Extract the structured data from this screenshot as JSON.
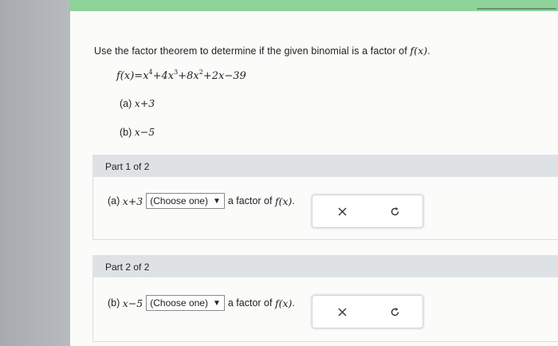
{
  "question": {
    "text_prefix": "Use the factor theorem to determine if the given binomial is a factor of",
    "func": "f",
    "func_arg": "(x)",
    "text_suffix": "."
  },
  "formula": {
    "lhs": "f(x)",
    "equals": "=",
    "t1": "x",
    "t1_exp": "4",
    "t2": "+4x",
    "t2_exp": "3",
    "t3": "+8x",
    "t3_exp": "2",
    "t4": "+2x−39"
  },
  "choices": [
    {
      "label": "(a)",
      "expr": "x+3"
    },
    {
      "label": "(b)",
      "expr": "x−5"
    }
  ],
  "parts": [
    {
      "title": "Part 1 of 2",
      "label": "(a)",
      "expr": "x+3",
      "dropdown": "(Choose one)",
      "suffix": "a factor of",
      "func": "f(x)",
      "end": "."
    },
    {
      "title": "Part 2 of 2",
      "label": "(b)",
      "expr": "x−5",
      "dropdown": "(Choose one)",
      "suffix": "a factor of",
      "func": "f(x)",
      "end": "."
    }
  ],
  "icons": {
    "clear": "close-icon",
    "reset": "redo-icon"
  },
  "colors": {
    "top_bar": "#8ed49a",
    "band": "#dfe2e4",
    "background": "#b9bcbf"
  }
}
